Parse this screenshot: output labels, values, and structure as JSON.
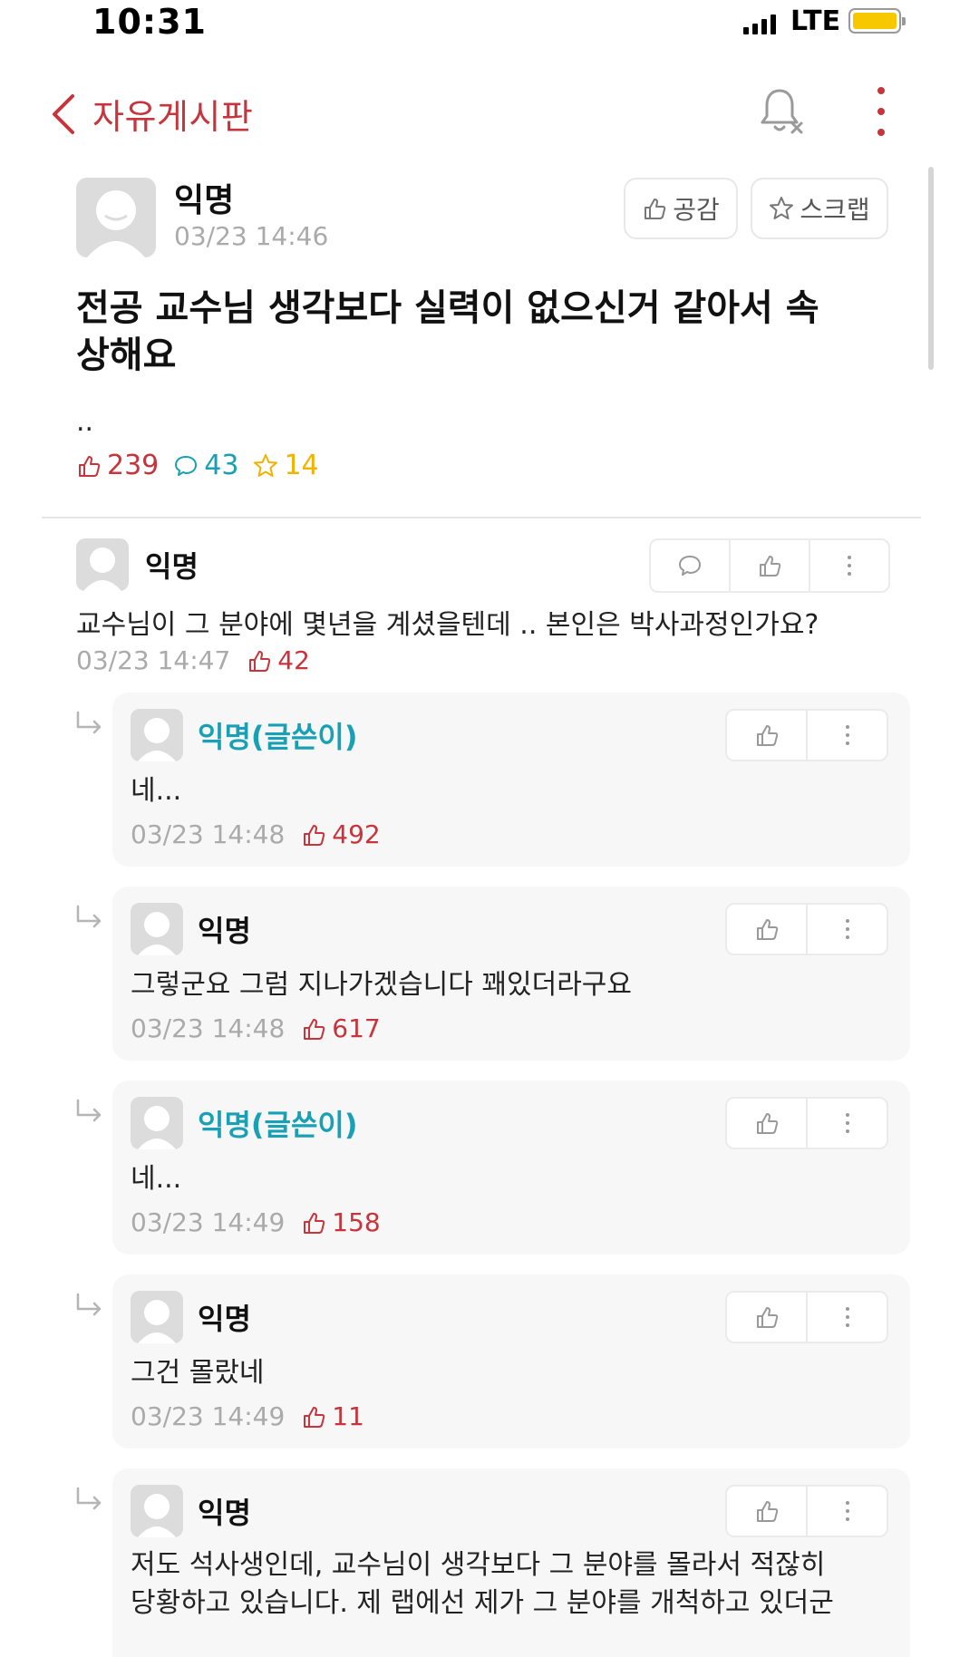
{
  "status_bar": {
    "time": "10:31",
    "network": "LTE"
  },
  "header": {
    "back_icon": "chevron-left-icon",
    "board_title": "자유게시판",
    "bell_icon": "bell-off-icon",
    "more_icon": "more-vertical-icon"
  },
  "post": {
    "author": "익명",
    "date": "03/23 14:46",
    "like_button": "공감",
    "scrap_button": "스크랩",
    "title": "전공 교수님 생각보다 실력이 없으신거 같아서 속상해요",
    "body": "..",
    "stats": {
      "likes": "239",
      "comments": "43",
      "scraps": "14"
    }
  },
  "comment": {
    "author": "익명",
    "text": "교수님이 그 분야에 몇년을 계셨을텐데 .. 본인은 박사과정인가요?",
    "date": "03/23 14:47",
    "likes": "42"
  },
  "replies": [
    {
      "author": "익명(글쓴이)",
      "text": "네...",
      "date": "03/23 14:48",
      "likes": "492"
    },
    {
      "author": "익명",
      "text": "그렇군요 그럼 지나가겠습니다 꽤있더라구요",
      "date": "03/23 14:48",
      "likes": "617"
    },
    {
      "author": "익명(글쓴이)",
      "text": "네...",
      "date": "03/23 14:49",
      "likes": "158"
    },
    {
      "author": "익명",
      "text": "그건 몰랐네",
      "date": "03/23 14:49",
      "likes": "11"
    },
    {
      "author": "익명",
      "text_line1": "저도 석사생인데, 교수님이 생각보다 그 분야를 몰라서 적잖히",
      "text_line2": "당황하고 있습니다. 제 랩에선 제가 그 분야를 개척하고 있더군"
    }
  ],
  "colors": {
    "accent": "#c6343c",
    "op_author": "#1aa0b4",
    "scrap": "#f2b200",
    "meta": "#aaaaaa"
  }
}
